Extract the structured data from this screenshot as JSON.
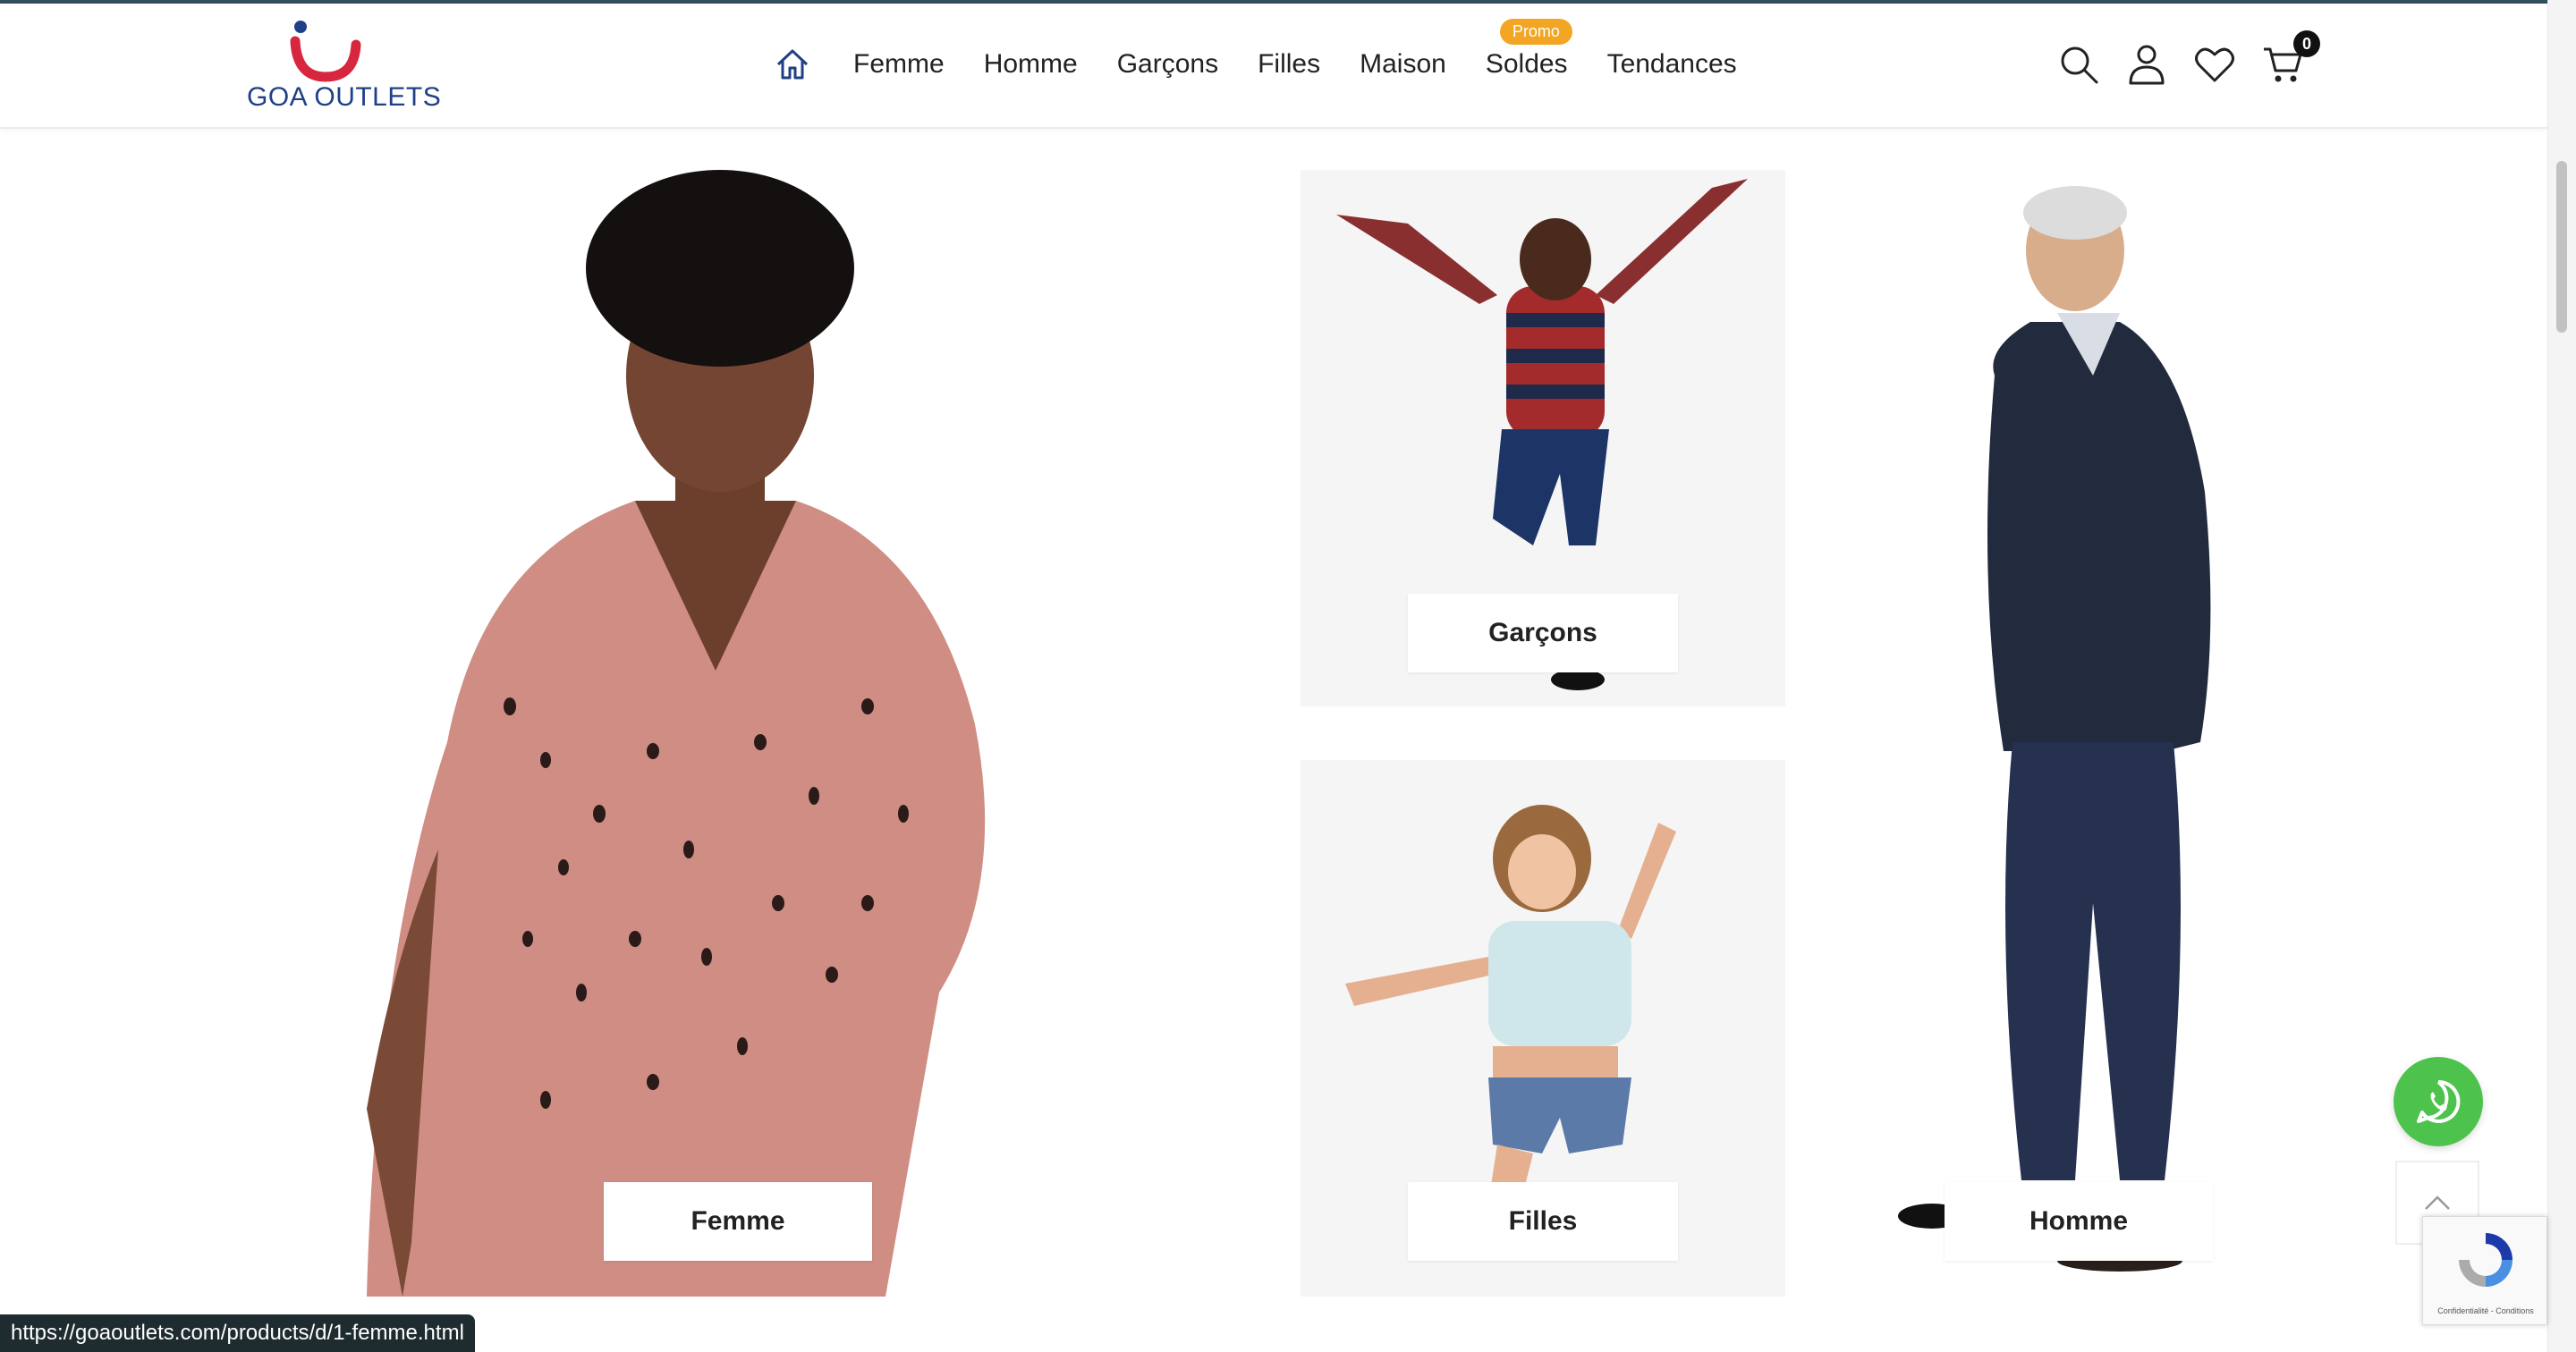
{
  "header": {
    "logo_text": "GOA OUTLETS",
    "nav": [
      {
        "label": "Femme"
      },
      {
        "label": "Homme"
      },
      {
        "label": "Garçons"
      },
      {
        "label": "Filles"
      },
      {
        "label": "Maison"
      },
      {
        "label": "Soldes",
        "badge": "Promo"
      },
      {
        "label": "Tendances"
      }
    ],
    "icons": [
      "home-icon",
      "search-icon",
      "user-icon",
      "heart-icon",
      "cart-icon"
    ],
    "cart_count": "0"
  },
  "categories": {
    "femme": "Femme",
    "garcons": "Garçons",
    "filles": "Filles",
    "homme": "Homme"
  },
  "recaptcha": {
    "text": "Confidentialité - Conditions"
  },
  "status_url": "https://goaoutlets.com/products/d/1-femme.html",
  "colors": {
    "header_line": "#2f4f5a",
    "logo_blue": "#1f3f86",
    "logo_red": "#d7263d",
    "promo_badge": "#f3a623",
    "whatsapp": "#4dc34d"
  }
}
